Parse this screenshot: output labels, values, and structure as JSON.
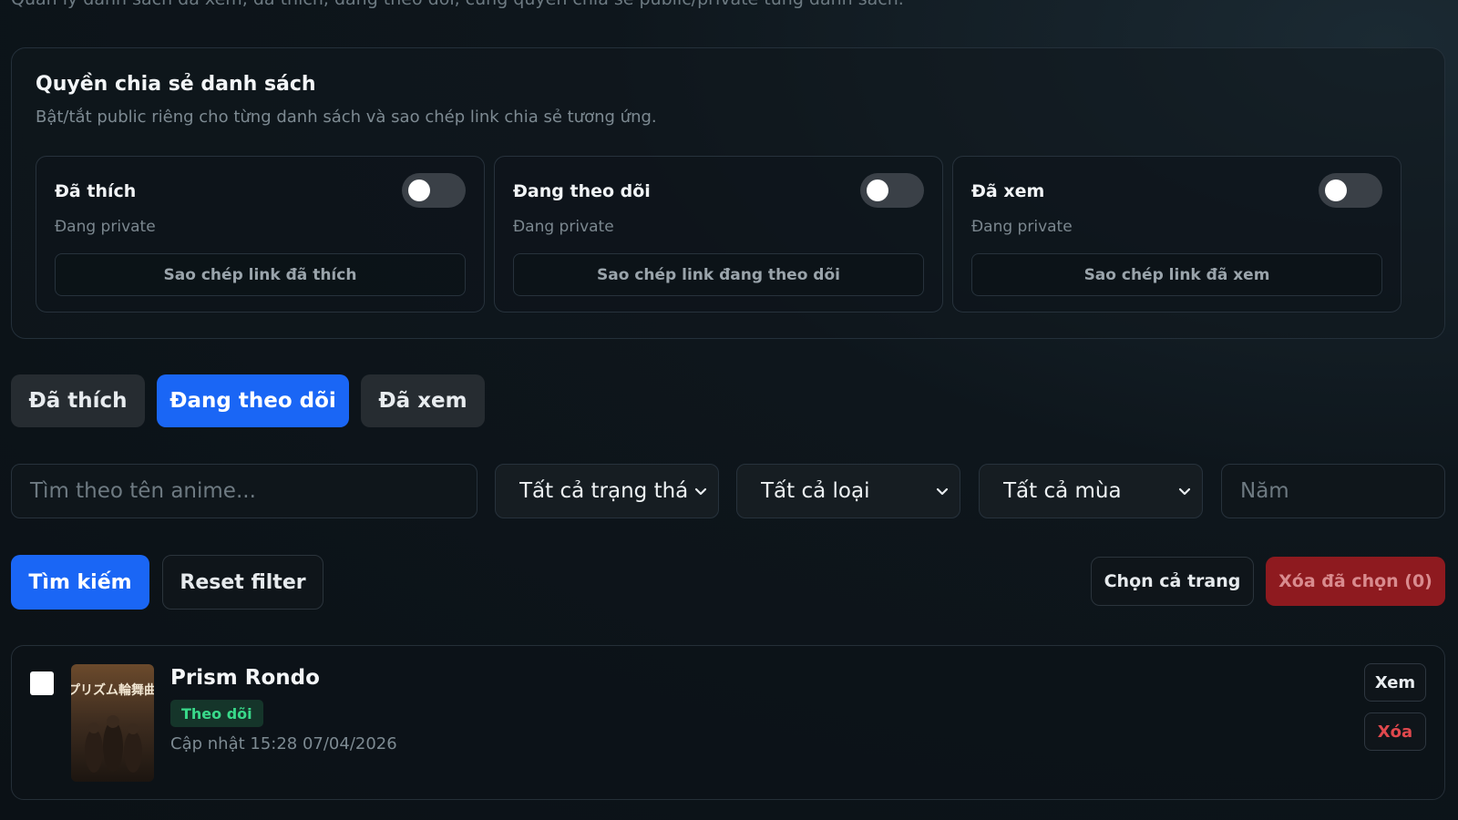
{
  "page": {
    "description": "Quản lý danh sách đã xem, đã thích, đang theo dõi, cùng quyền chia sẻ public/private từng danh sách."
  },
  "share": {
    "title": "Quyền chia sẻ danh sách",
    "subtitle": "Bật/tắt public riêng cho từng danh sách và sao chép link chia sẻ tương ứng.",
    "cards": [
      {
        "name": "Đã thích",
        "state": "Đang private",
        "public": false,
        "copy_label": "Sao chép link đã thích"
      },
      {
        "name": "Đang theo dõi",
        "state": "Đang private",
        "public": false,
        "copy_label": "Sao chép link đang theo dõi"
      },
      {
        "name": "Đã xem",
        "state": "Đang private",
        "public": false,
        "copy_label": "Sao chép link đã xem"
      }
    ]
  },
  "tabs": [
    {
      "label": "Đã thích",
      "active": false
    },
    {
      "label": "Đang theo dõi",
      "active": true
    },
    {
      "label": "Đã xem",
      "active": false
    }
  ],
  "filters": {
    "search_placeholder": "Tìm theo tên anime...",
    "status_value": "Tất cả trạng thái",
    "type_value": "Tất cả loại",
    "season_value": "Tất cả mùa",
    "year_placeholder": "Năm"
  },
  "actions": {
    "search": "Tìm kiếm",
    "reset": "Reset filter",
    "select_page": "Chọn cả trang",
    "delete_selected": "Xóa đã chọn (0)"
  },
  "items": [
    {
      "title": "Prism Rondo",
      "poster_text": "プリズム輪舞曲",
      "badge": "Theo dõi",
      "updated": "Cập nhật 15:28 07/04/2026",
      "view_label": "Xem",
      "delete_label": "Xóa"
    }
  ],
  "colors": {
    "accent": "#1a66f5",
    "danger": "#8e1a1f",
    "success": "#39d98a",
    "background": "#0b1116"
  }
}
